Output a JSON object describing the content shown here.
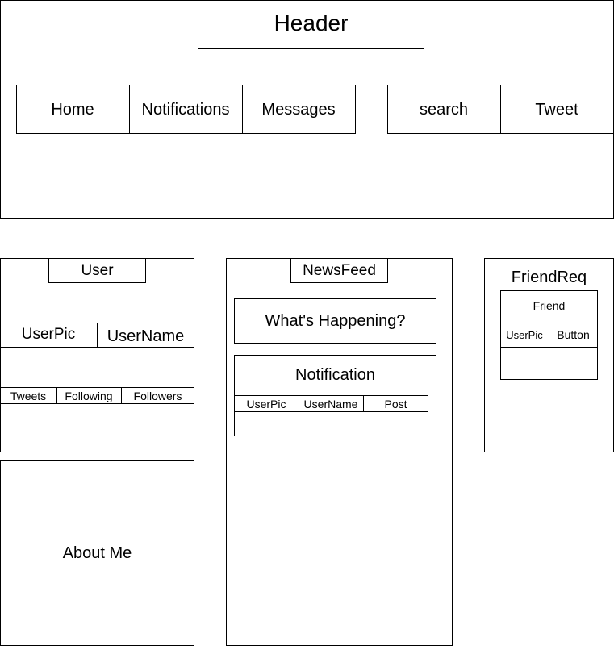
{
  "header": {
    "title": "Header",
    "nav": {
      "home": "Home",
      "notifications": "Notifications",
      "messages": "Messages"
    },
    "actions": {
      "search": "search",
      "tweet": "Tweet"
    }
  },
  "user_panel": {
    "title": "User",
    "userpic": "UserPic",
    "username": "UserName",
    "stats": {
      "tweets": "Tweets",
      "following": "Following",
      "followers": "Followers"
    }
  },
  "about": {
    "title": "About Me"
  },
  "newsfeed": {
    "title": "NewsFeed",
    "whats_happening": "What's Happening?",
    "notification": {
      "title": "Notification",
      "userpic": "UserPic",
      "username": "UserName",
      "post": "Post"
    }
  },
  "friendreq": {
    "title": "FriendReq",
    "friend": {
      "title": "Friend",
      "userpic": "UserPic",
      "button": "Button"
    }
  }
}
